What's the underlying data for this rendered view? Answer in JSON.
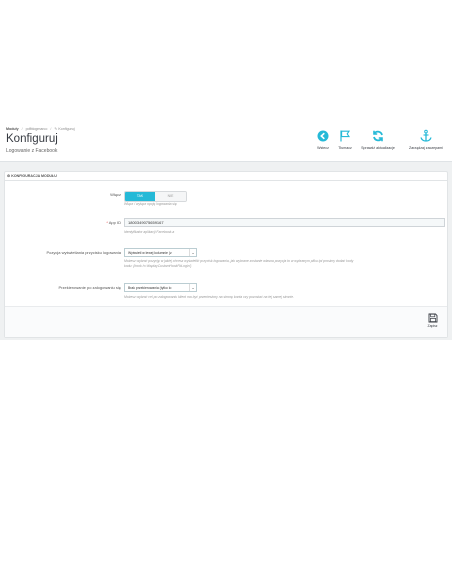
{
  "breadcrumb": {
    "items": [
      "Moduły",
      "pdfblogmarco",
      "Konfiguruj"
    ],
    "sep": "/"
  },
  "page": {
    "title": "Konfiguruj",
    "subtitle": "Logowanie z Facebook"
  },
  "toolbar": {
    "buttons": [
      {
        "label": "Wstecz",
        "icon": "back-circle-icon"
      },
      {
        "label": "Tłumacz",
        "icon": "flag-icon"
      },
      {
        "label": "Sprawdź aktualizacje",
        "icon": "refresh-icon"
      },
      {
        "label": "Zarządzaj zaczepami",
        "icon": "anchor-icon"
      }
    ]
  },
  "panel": {
    "heading": "KONFIGURACJA MODUŁU",
    "enable": {
      "label": "Włącz",
      "on": "TAK",
      "off": "NIE",
      "help": "Włącz / wyłącz opcję logowania się"
    },
    "appid": {
      "required_mark": "*",
      "label": "App ID",
      "value": "1800349075659167",
      "help": "Identyfikator aplikacji Facebook-a"
    },
    "position": {
      "label": "Pozycja wyświetlania przycisku logowania",
      "value": "Wyświetl w lewej kolumnie (z",
      "help1": "Możesz wybrać pozycję w jakiej chcesz wyświetlić przycisk logowania, jak wybrane zostanie własna pozycja to w wybranym pliku tpl prosimy dodać kody",
      "help2": "kodu: {hook h='displayCustomHookFbLogin'}"
    },
    "redirect": {
      "label": "Przekierowanie po zalogowaniu się",
      "value": "Brak przekierowania (tylko lo",
      "help": "Możesz wybrać cel po zalogowaniu klient ma być przeniesiony na stronę konta czy pozostać na tej samej stronie."
    },
    "save_label": "Zapisz"
  },
  "colors": {
    "accent": "#25b9d7",
    "title": "#363a41",
    "background": "#eff1f2"
  }
}
